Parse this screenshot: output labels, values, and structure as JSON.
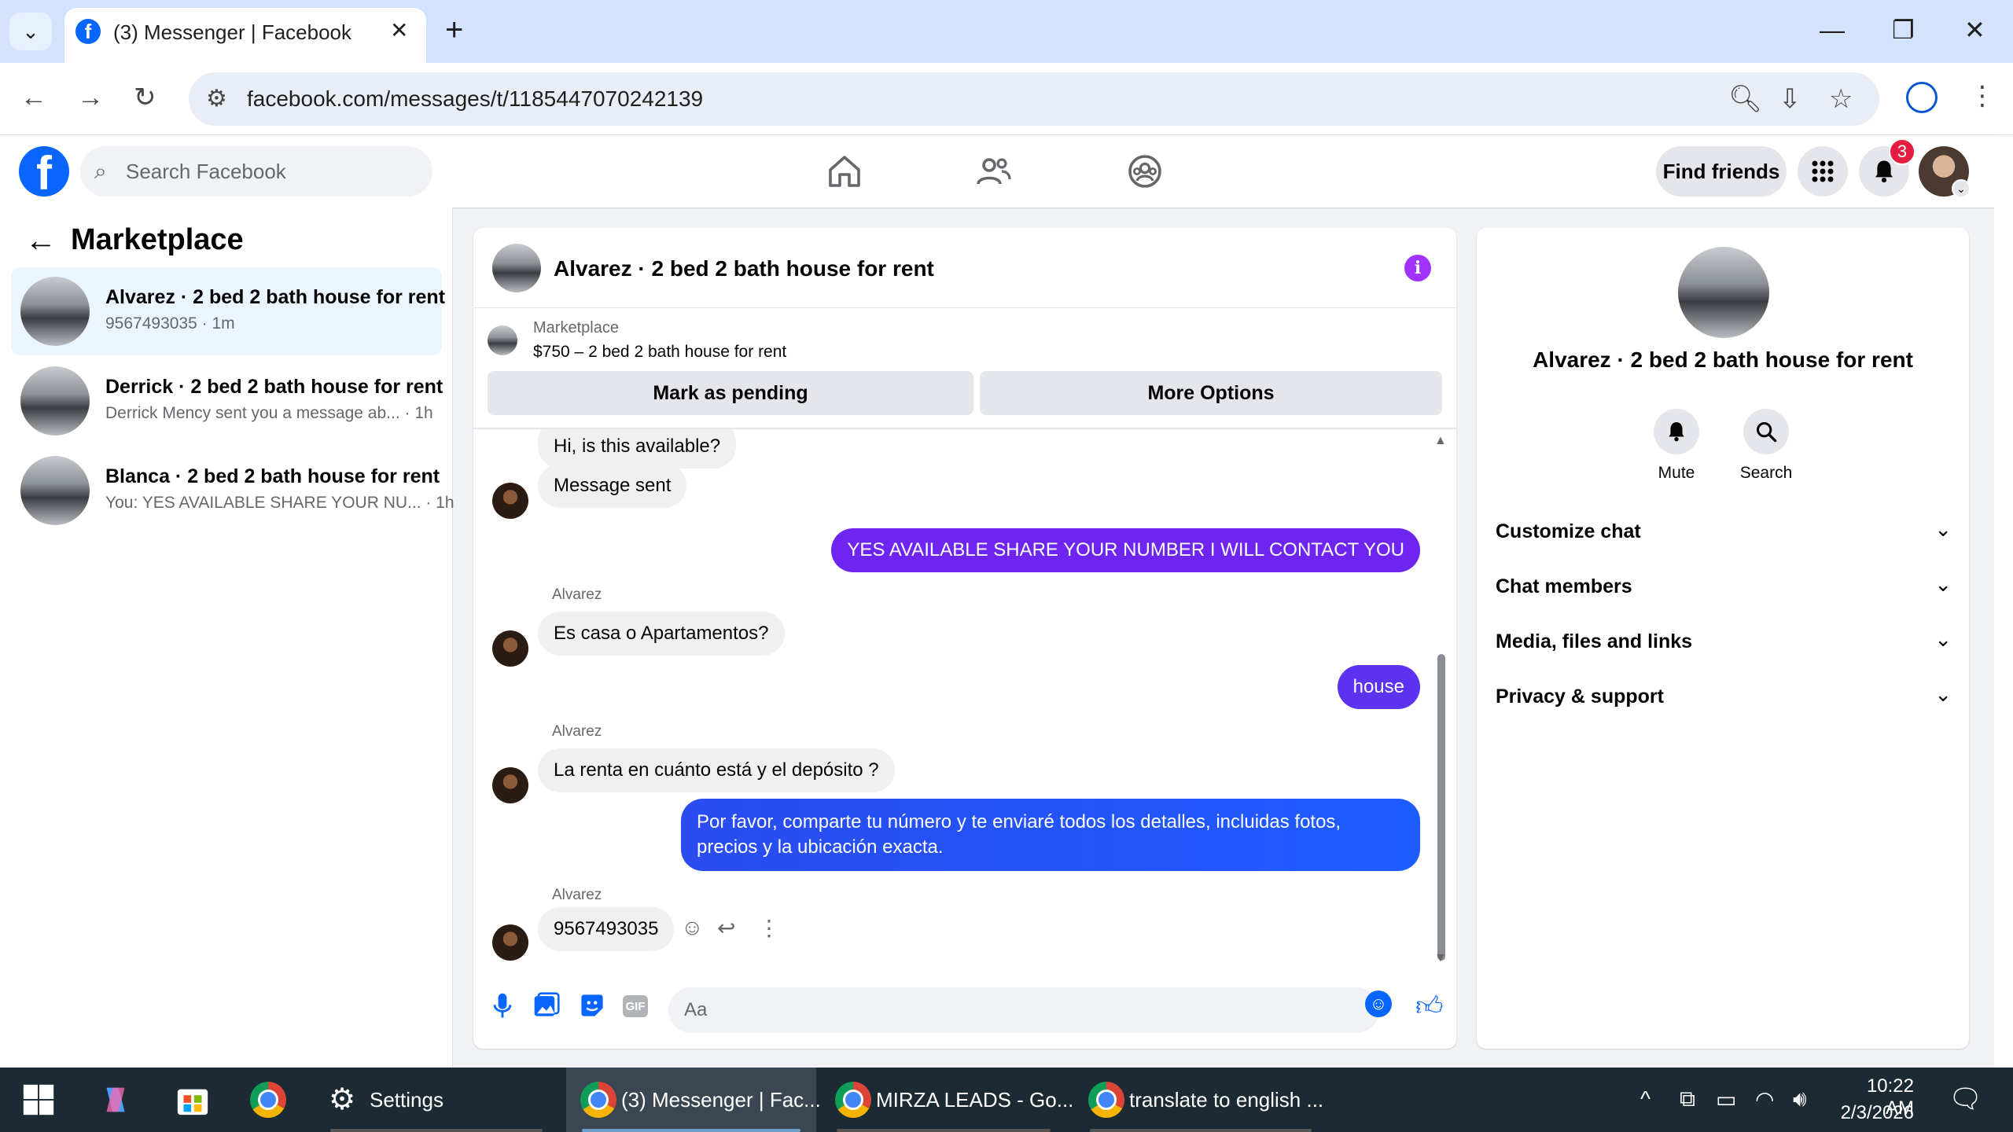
{
  "browser": {
    "tab_title": "(3) Messenger | Facebook",
    "url": "facebook.com/messages/t/1185447070242139"
  },
  "fb_header": {
    "search_placeholder": "Search Facebook",
    "find_friends": "Find friends",
    "notification_count": "3"
  },
  "sidebar": {
    "title": "Marketplace",
    "conversations": [
      {
        "name": "Alvarez · 2 bed 2 bath house for rent",
        "snippet": "9567493035 · 1m",
        "active": true
      },
      {
        "name": "Derrick · 2 bed 2 bath house for rent",
        "snippet": "Derrick Mency sent you a message ab... · 1h",
        "active": false
      },
      {
        "name": "Blanca · 2 bed 2 bath house for rent",
        "snippet": "You: YES AVAILABLE SHARE YOUR NU... · 1h",
        "active": false
      }
    ]
  },
  "chat": {
    "title": "Alvarez · 2 bed 2 bath house for rent",
    "marketplace_label": "Marketplace",
    "listing": "$750 – 2 bed 2 bath house for rent",
    "mark_pending": "Mark as pending",
    "more_options": "More Options",
    "messages": {
      "m1": "Hi, is this available?",
      "m2": "Message sent",
      "m3": "YES AVAILABLE SHARE YOUR NUMBER I WILL CONTACT YOU",
      "sender": "Alvarez",
      "m4": "Es casa o Apartamentos?",
      "m5": "house",
      "m6": "La renta en cuánto está y el depósito ?",
      "m7": "Por favor, comparte tu número y te enviaré todos los detalles, incluidas fotos, precios y la ubicación exacta.",
      "m8": "9567493035"
    },
    "composer_placeholder": "Aa"
  },
  "right_panel": {
    "title": "Alvarez · 2 bed 2 bath house for rent",
    "mute": "Mute",
    "search": "Search",
    "sections": [
      "Customize chat",
      "Chat members",
      "Media, files and links",
      "Privacy & support"
    ]
  },
  "taskbar": {
    "settings": "Settings",
    "app1": "(3) Messenger | Fac...",
    "app2": "MIRZA LEADS - Go...",
    "app3": "translate to english ...",
    "time": "10:22 AM",
    "date": "2/3/2026"
  },
  "colors": {
    "fb_blue": "#0866ff",
    "outgoing_purple": "#7e1cff",
    "outgoing_blue": "#1d5cff",
    "active_conv_bg": "#ebf5ff",
    "taskbar_bg": "#1c2a33"
  }
}
